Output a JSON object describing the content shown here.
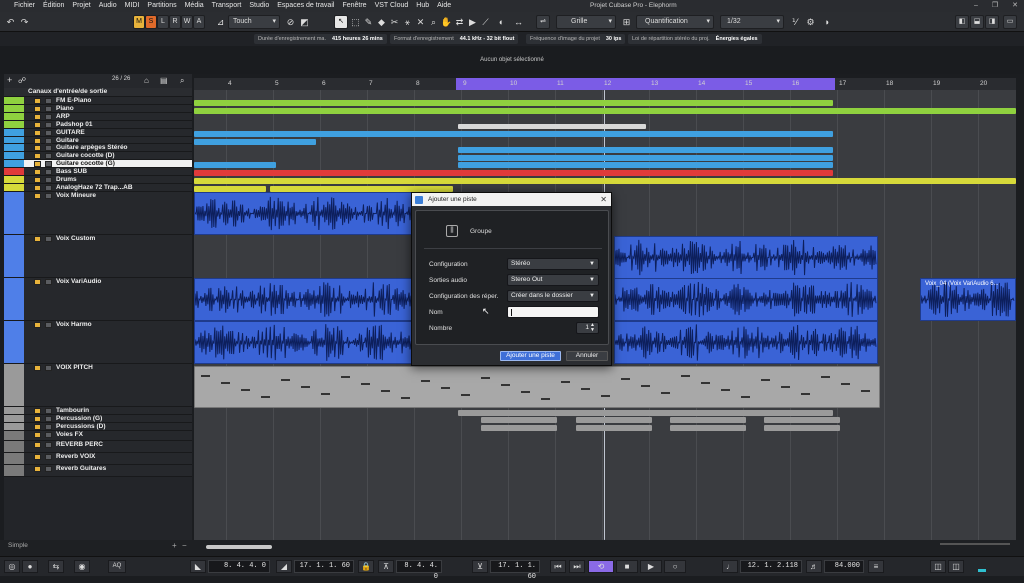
{
  "window": {
    "title": "Projet Cubase Pro - Elephorm",
    "menu": [
      "Fichier",
      "Édition",
      "Projet",
      "Audio",
      "MIDI",
      "Partitions",
      "Média",
      "Transport",
      "Studio",
      "Espaces de travail",
      "Fenêtre",
      "VST Cloud",
      "Hub",
      "Aide"
    ]
  },
  "toolbar": {
    "modes": [
      "M",
      "S",
      "L",
      "R",
      "W",
      "A"
    ],
    "automation_mode": "Touch",
    "snap_type": "Grille",
    "quantize_label": "Quantification",
    "quantize_value": "1/32"
  },
  "info": {
    "rec_time_label": "Durée d'enregistrement ma.",
    "rec_time_value": "415 heures 26 mins",
    "format_label": "Format d'enregistrement",
    "format_value": "44.1 kHz - 32 bit flout",
    "fps_label": "Fréquence d'image du projet",
    "fps_value": "30 ips",
    "pan_label": "Loi de répartition stéréo du proj.",
    "pan_value": "Énergies égales"
  },
  "selection_info": "Aucun objet sélectionné",
  "tracklist": {
    "count": "26 / 26",
    "folder_label": "Canaux d'entrée/de sortie",
    "tracks": [
      {
        "name": "FM E-Piano",
        "color": "#8fd13f"
      },
      {
        "name": "Piano",
        "color": "#8fd13f"
      },
      {
        "name": "ARP",
        "color": "#8fd13f"
      },
      {
        "name": "Padshop 01",
        "color": "#8fd13f"
      },
      {
        "name": "GUITARE",
        "color": "#3fa0e0"
      },
      {
        "name": "Guitare",
        "color": "#3fa0e0"
      },
      {
        "name": "Guitare arpèges Stéréo",
        "color": "#3fa0e0"
      },
      {
        "name": "Guitare cocotte (D)",
        "color": "#3fa0e0"
      },
      {
        "name": "Guitare cocotte (G)",
        "color": "#3fa0e0"
      },
      {
        "name": "Bass SUB",
        "color": "#e03a3a"
      },
      {
        "name": "Drums",
        "color": "#d6d93a"
      },
      {
        "name": "AnalogHaze 72 Trap...AB",
        "color": "#d6d93a"
      },
      {
        "name": "Voix Mineure",
        "color": "#4f7fe8"
      },
      {
        "name": "Voix Custom",
        "color": "#4f7fe8"
      },
      {
        "name": "Voix VariAudio",
        "color": "#4f7fe8"
      },
      {
        "name": "Voix Harmo",
        "color": "#4f7fe8"
      },
      {
        "name": "VOIX PITCH",
        "color": "#9a9a9a"
      },
      {
        "name": "Tambourin",
        "color": "#9a9a9a"
      },
      {
        "name": "Percussion (G)",
        "color": "#9a9a9a"
      },
      {
        "name": "Percussions (D)",
        "color": "#9a9a9a"
      },
      {
        "name": "Voies FX",
        "color": "#7a7a7a"
      },
      {
        "name": "REVERB PERC",
        "color": "#7a7a7a"
      },
      {
        "name": "Reverb VOIX",
        "color": "#7a7a7a"
      },
      {
        "name": "Reverb Guitares",
        "color": "#7a7a7a"
      }
    ]
  },
  "ruler": {
    "bars": [
      "4",
      "5",
      "6",
      "7",
      "8",
      "9",
      "10",
      "11",
      "12",
      "13",
      "14",
      "15",
      "16",
      "17",
      "18",
      "19",
      "20"
    ]
  },
  "events": {
    "voix_variaudio_clip": "Voix_04 (Voix VariAudio 6..."
  },
  "dialog": {
    "title": "Ajouter une piste",
    "track_type": "Groupe",
    "config_label": "Configuration",
    "config_value": "Stéréo",
    "outputs_label": "Sorties audio",
    "outputs_value": "Stereo Out",
    "folder_label": "Configuration des réper.",
    "folder_value": "Créer dans le dossier",
    "name_label": "Nom",
    "name_value": "",
    "count_label": "Nombre",
    "count_value": "1",
    "ok_label": "Ajouter une piste",
    "cancel_label": "Annuler"
  },
  "status": {
    "mode": "Simple"
  },
  "transport": {
    "left_locator": "8. 4. 4. 0",
    "right_locator": "17. 1. 1. 60",
    "punch_in": "8. 4. 4. 0",
    "punch_out": "17. 1. 1. 60",
    "position": "12. 1. 2.118",
    "tempo": "84.000",
    "aq_label": "AQ"
  }
}
